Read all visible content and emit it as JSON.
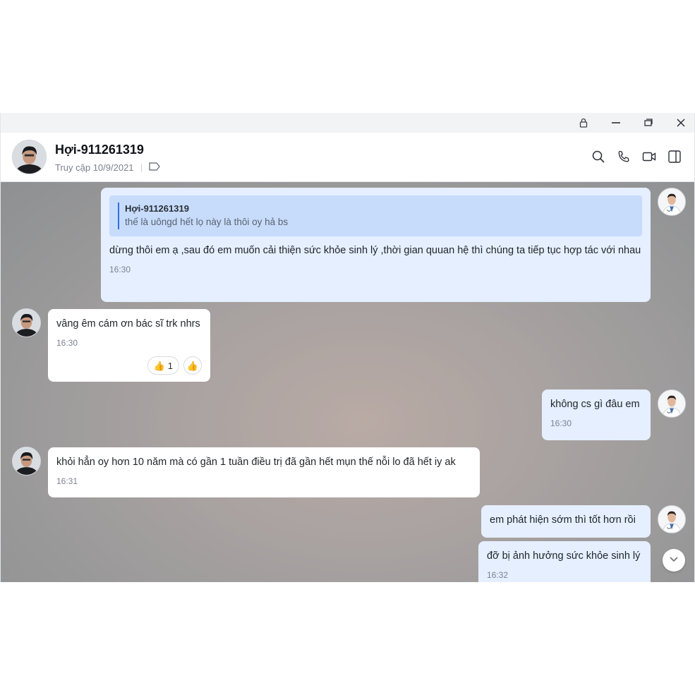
{
  "contact": {
    "name": "Hợi-911261319",
    "last_access": "Truy cập 10/9/2021"
  },
  "icons": {
    "titlebar": [
      "lock-icon",
      "minimize-icon",
      "restore-icon",
      "close-icon"
    ],
    "header": [
      "search-icon",
      "phone-icon",
      "video-call-icon",
      "sidebar-toggle-icon",
      "tag-icon"
    ],
    "thumbs_up": "👍"
  },
  "messages": [
    {
      "side": "me",
      "quote": {
        "name": "Hợi-911261319",
        "text": "thế là uôngd hết lọ này là thôi oy hả bs"
      },
      "text": "dừng thôi em ạ ,sau đó em muốn cải thiện sức khỏe sinh lý ,thời gian quuan hệ thì chúng ta tiếp tục hợp tác với nhau",
      "time": "16:30"
    },
    {
      "side": "them",
      "text": "vâng êm cám ơn bác sĩ trk nhrs",
      "time": "16:30",
      "reaction_count": "1"
    },
    {
      "side": "me",
      "text": "không cs gì đâu em",
      "time": "16:30"
    },
    {
      "side": "them",
      "text": "khỏi hẳn oy hơn 10 năm mà có gần 1 tuần điều trị đã gần hết mụn thế nỗi lo đã hết iy ak",
      "time": "16:31"
    },
    {
      "side": "me",
      "text": "em phát hiện sớm thì tốt hơn rồi"
    },
    {
      "side": "me",
      "text": "đỡ bị ảnh hưởng sức khỏe sinh lý",
      "time": "16:32"
    }
  ],
  "colors": {
    "my_bubble": "#e5efff",
    "their_bubble": "#ffffff",
    "quote_bg": "#c7dcfb",
    "quote_bar": "#2f6fe0"
  }
}
